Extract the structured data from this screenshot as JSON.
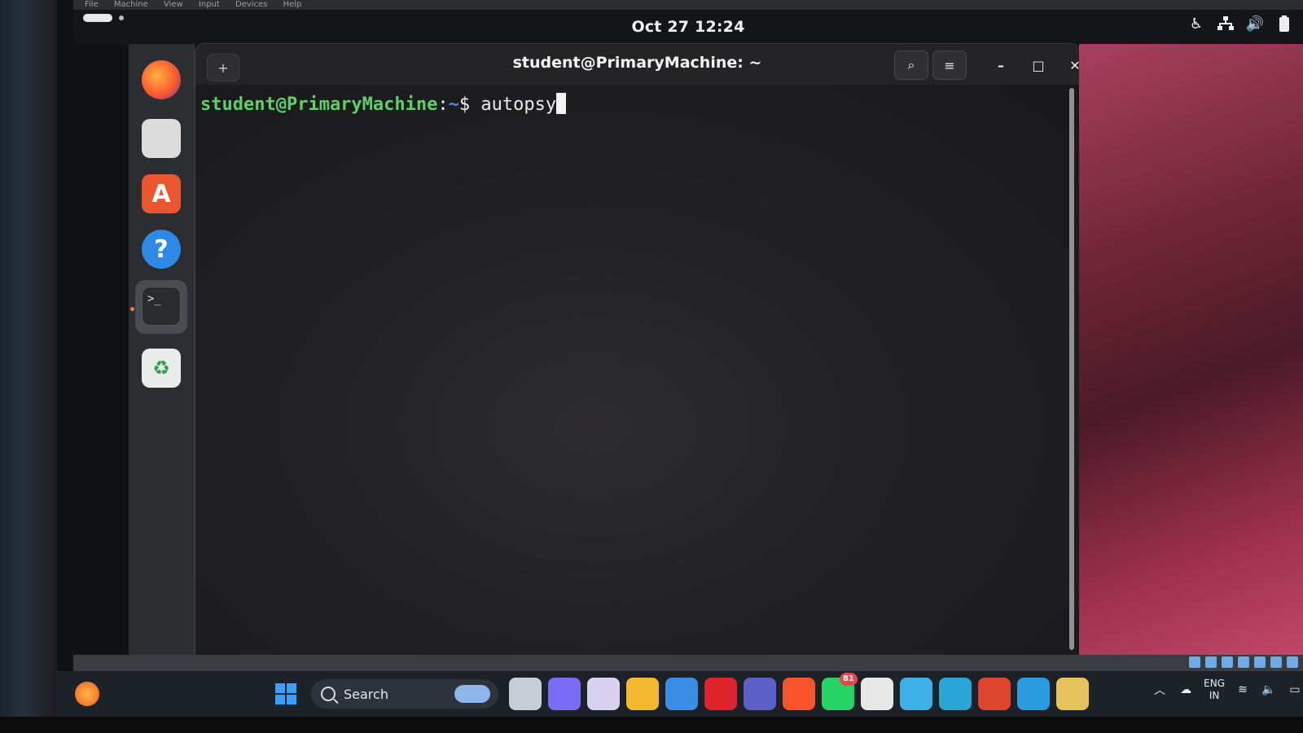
{
  "vm_menubar": [
    "File",
    "Machine",
    "View",
    "Input",
    "Devices",
    "Help"
  ],
  "topbar": {
    "clock": "Oct 27  12:24",
    "tray_icons": [
      "accessibility-icon",
      "network-icon",
      "volume-icon",
      "battery-icon"
    ]
  },
  "dock": {
    "items": [
      "firefox-icon",
      "files-icon",
      "app-center-icon",
      "help-icon",
      "terminal-icon",
      "trash-icon"
    ],
    "help_glyph": "?",
    "appstore_glyph": "A",
    "terminal_glyph": ">_",
    "trash_glyph": "♻"
  },
  "terminal": {
    "title": "student@PrimaryMachine: ~",
    "prompt_user": "student@PrimaryMachine",
    "prompt_sep": ":",
    "prompt_path": "~",
    "prompt_symbol": "$ ",
    "command": "autopsy",
    "buttons": {
      "new_tab": "+",
      "search": "⌕",
      "menu": "≡",
      "minimize": "–",
      "maximize": "□",
      "close": "✕"
    }
  },
  "taskbar": {
    "search_label": "Search",
    "apps": [
      {
        "name": "task-view-icon",
        "color": "#c7cdd6"
      },
      {
        "name": "copilot-icon",
        "color": "#7b6cf6"
      },
      {
        "name": "yahoo-mail-icon",
        "color": "#d8d2f0"
      },
      {
        "name": "file-explorer-icon",
        "color": "#f2b830"
      },
      {
        "name": "ms-store-icon",
        "color": "#3a8ee6"
      },
      {
        "name": "opera-icon",
        "color": "#e0242e"
      },
      {
        "name": "teams-icon",
        "color": "#5b5fc7"
      },
      {
        "name": "brave-icon",
        "color": "#fb542b"
      },
      {
        "name": "whatsapp-icon",
        "color": "#25d366",
        "badge": "81"
      },
      {
        "name": "threads-icon",
        "color": "#e8e8e8"
      },
      {
        "name": "notepad-icon",
        "color": "#3fb0e8"
      },
      {
        "name": "vs-icon",
        "color": "#2aa6d6"
      },
      {
        "name": "chrome-icon",
        "color": "#e0462e"
      },
      {
        "name": "edge-icon",
        "color": "#2b9be0"
      },
      {
        "name": "virtualbox-icon",
        "color": "#e6c25a"
      }
    ],
    "lang_line1": "ENG",
    "lang_line2": "IN"
  }
}
